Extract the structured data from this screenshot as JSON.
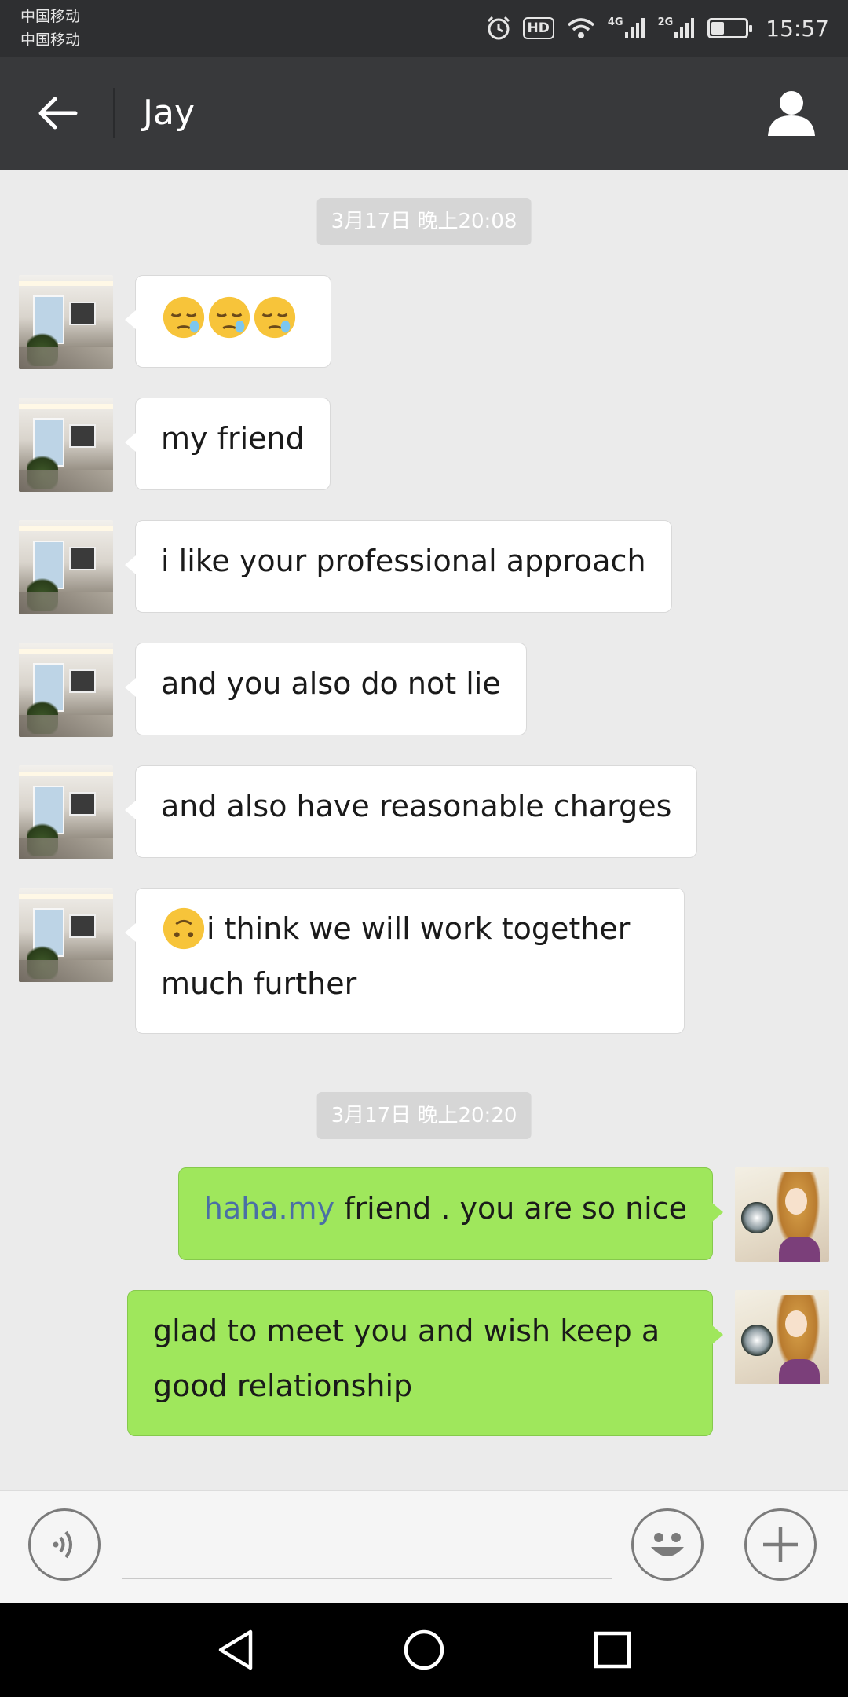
{
  "status_bar": {
    "carrier_1": "中国移动",
    "carrier_2": "中国移动",
    "hd_label": "HD",
    "net_1": "4G",
    "net_2": "2G",
    "time": "15:57",
    "battery_level": 0.34,
    "icons": [
      "alarm-icon",
      "hd-icon",
      "wifi-icon",
      "signal-icon",
      "signal-icon",
      "battery-icon"
    ]
  },
  "header": {
    "title": "Jay",
    "back_icon": "back-arrow-icon",
    "profile_icon": "user-profile-icon"
  },
  "chat": {
    "timestamps": [
      "3月17日 晚上20:08",
      "3月17日 晚上20:20"
    ],
    "incoming": [
      {
        "text": "",
        "emojis": [
          "sleepy-face",
          "sleepy-face",
          "sleepy-face"
        ]
      },
      {
        "text": "my friend"
      },
      {
        "text": "i like your professional approach"
      },
      {
        "text": "and you also do not lie"
      },
      {
        "text": "and also have reasonable charges"
      },
      {
        "text": "i think we will work together much further",
        "emoji": "upside-down-face"
      }
    ],
    "outgoing": [
      {
        "link": "haha.my",
        "text": " friend . you are so nice"
      },
      {
        "text": "glad to meet you and wish keep a good relationship"
      }
    ]
  },
  "input_bar": {
    "voice_icon": "voice-icon",
    "emoji_icon": "smiley-icon",
    "plus_icon": "plus-icon"
  },
  "nav_bar": {
    "icons": [
      "nav-back-icon",
      "nav-home-icon",
      "nav-recents-icon"
    ]
  },
  "colors": {
    "header": "#38393b",
    "status_bar": "#2e2f31",
    "chat_bg": "#ebebeb",
    "outgoing_bubble": "#9fe75c",
    "incoming_bubble": "#ffffff",
    "link": "#4a6fa5"
  }
}
